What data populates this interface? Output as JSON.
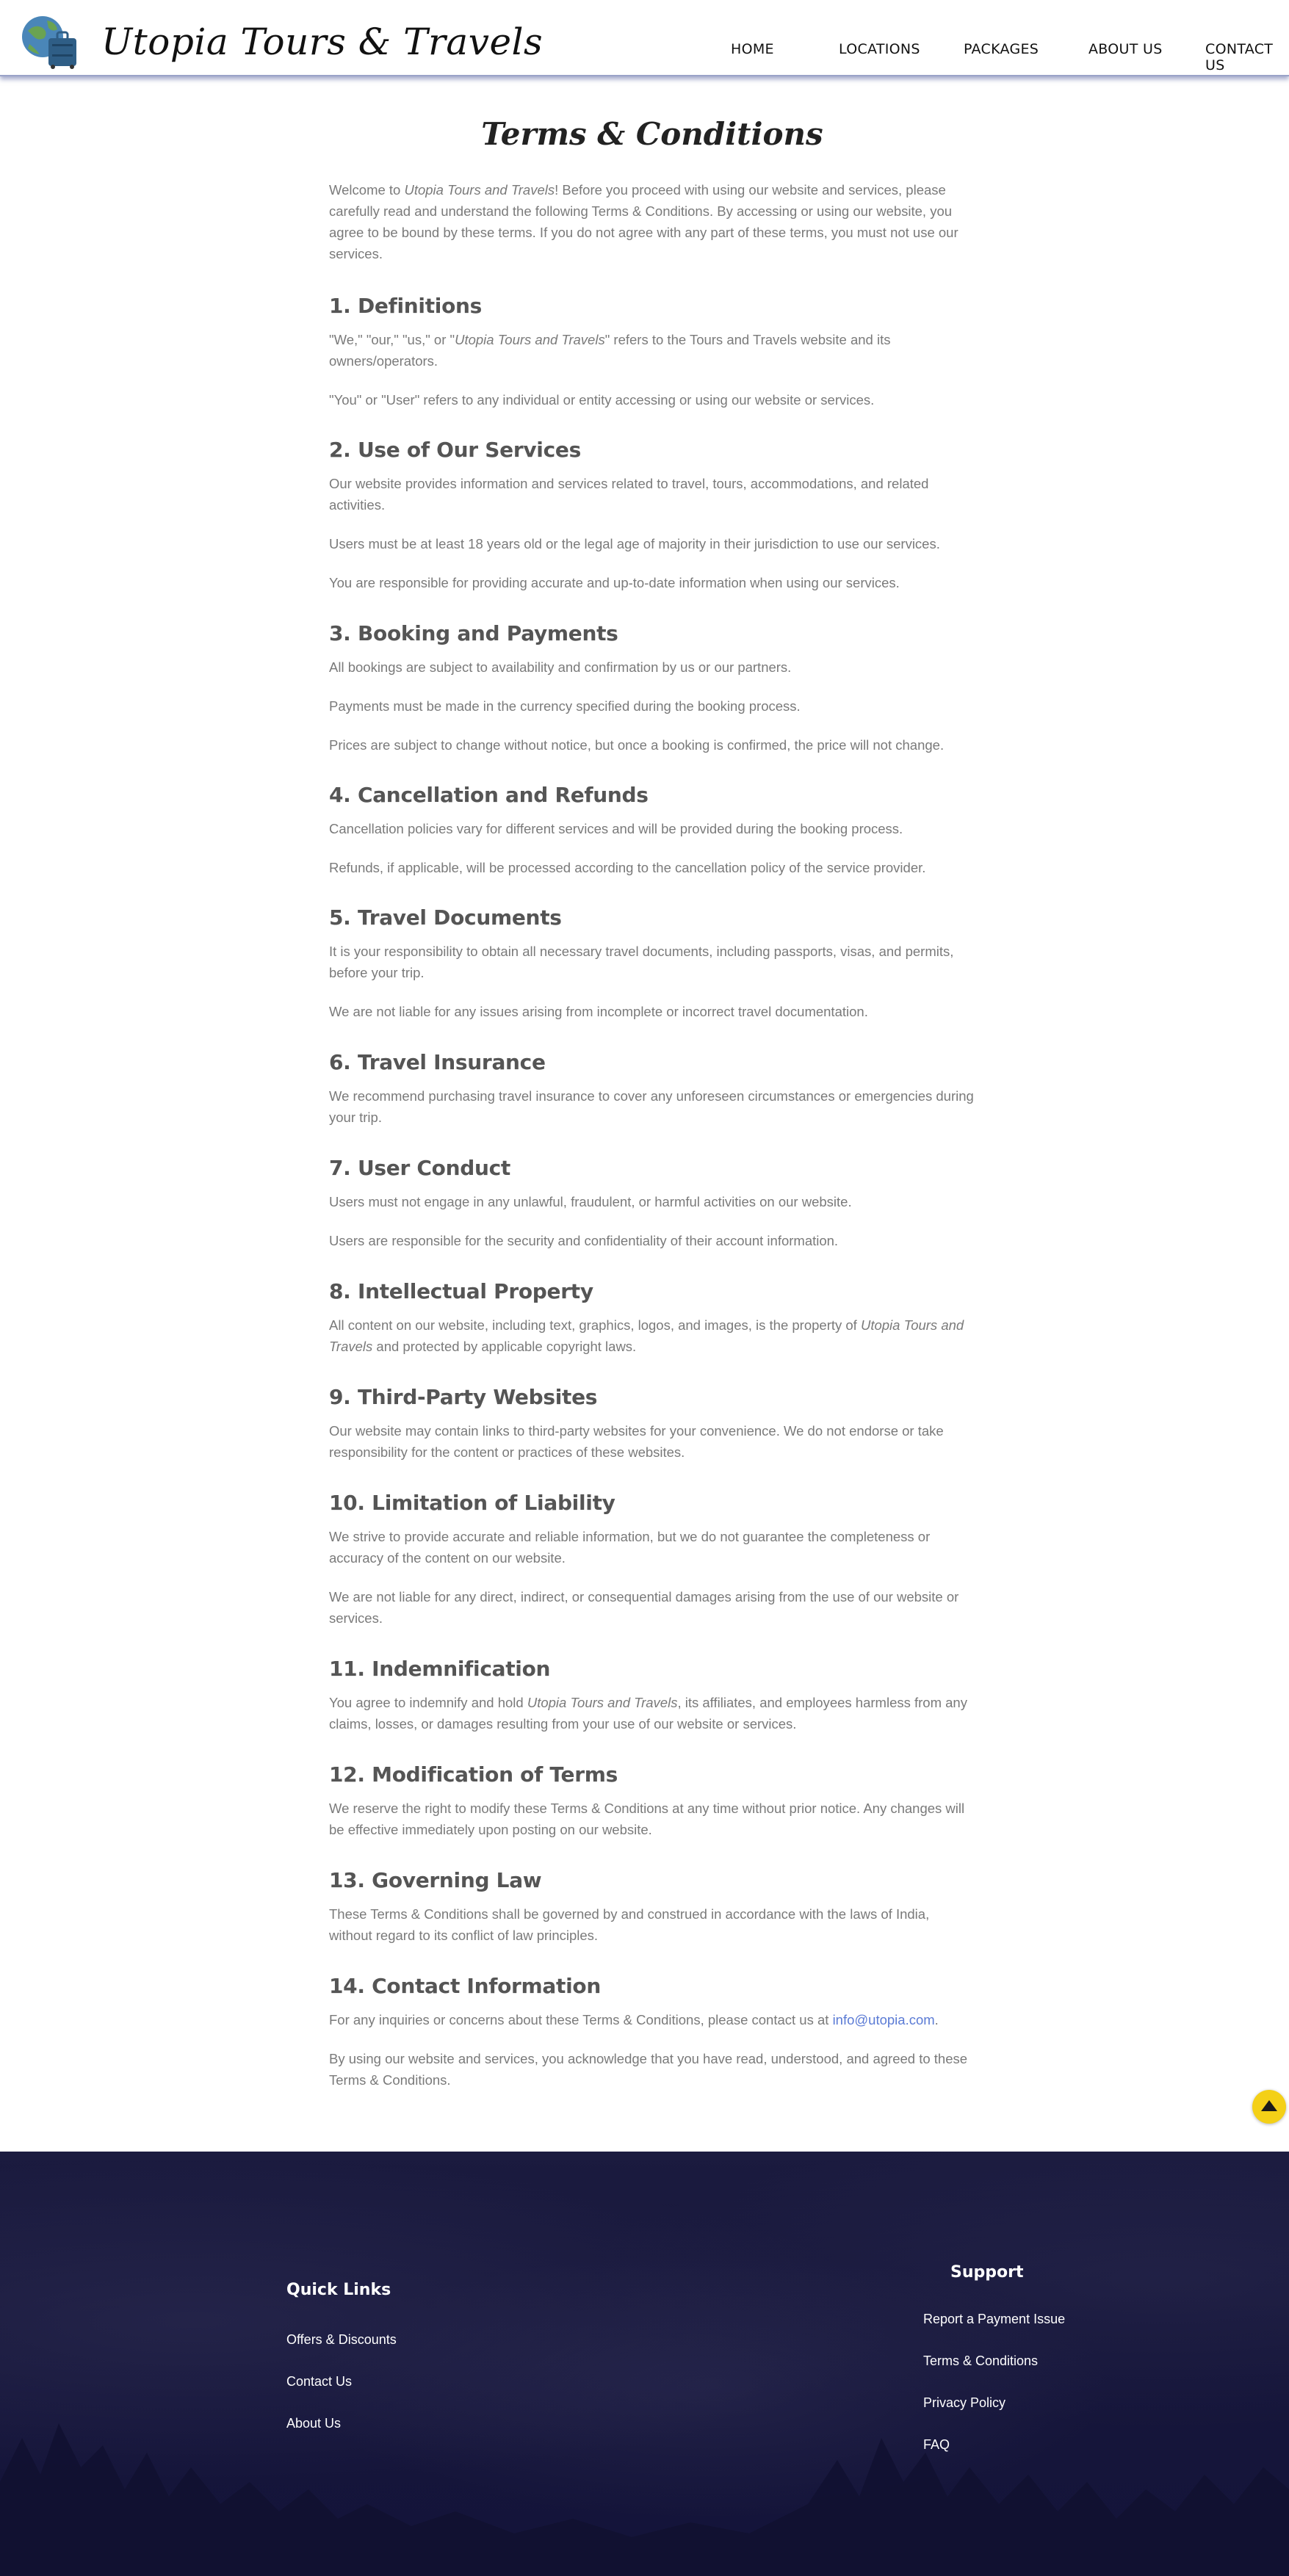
{
  "brand": {
    "name": "Utopia Tours & Travels"
  },
  "nav": {
    "items": [
      "HOME",
      "LOCATIONS",
      "PACKAGES",
      "ABOUT US",
      "CONTACT US"
    ]
  },
  "page": {
    "title": "Terms & Conditions",
    "intro": {
      "p1": "Welcome to ",
      "em1": "Utopia Tours and Travels",
      "p2": "! Before you proceed with using our website and services, please carefully read and understand the following Terms & Conditions. By accessing or using our website, you agree to be bound by these terms. If you do not agree with any part of these terms, you must not use our services."
    },
    "sections": {
      "definitions": {
        "heading": "1. Definitions",
        "p1a": "\"We,\" \"our,\" \"us,\" or \"",
        "p1em": "Utopia Tours and Travels",
        "p1b": "\" refers to the Tours and Travels website and its owners/operators.",
        "p2": "\"You\" or \"User\" refers to any individual or entity accessing or using our website or services."
      },
      "use": {
        "heading": "2. Use of Our Services",
        "p1": "Our website provides information and services related to travel, tours, accommodations, and related activities.",
        "p2": "Users must be at least 18 years old or the legal age of majority in their jurisdiction to use our services.",
        "p3": "You are responsible for providing accurate and up-to-date information when using our services."
      },
      "booking": {
        "heading": "3. Booking and Payments",
        "p1": "All bookings are subject to availability and confirmation by us or our partners.",
        "p2": "Payments must be made in the currency specified during the booking process.",
        "p3": "Prices are subject to change without notice, but once a booking is confirmed, the price will not change."
      },
      "cancellation": {
        "heading": "4. Cancellation and Refunds",
        "p1": "Cancellation policies vary for different services and will be provided during the booking process.",
        "p2": "Refunds, if applicable, will be processed according to the cancellation policy of the service provider."
      },
      "documents": {
        "heading": "5. Travel Documents",
        "p1": "It is your responsibility to obtain all necessary travel documents, including passports, visas, and permits, before your trip.",
        "p2": "We are not liable for any issues arising from incomplete or incorrect travel documentation."
      },
      "insurance": {
        "heading": "6. Travel Insurance",
        "p1": "We recommend purchasing travel insurance to cover any unforeseen circumstances or emergencies during your trip."
      },
      "conduct": {
        "heading": "7. User Conduct",
        "p1": "Users must not engage in any unlawful, fraudulent, or harmful activities on our website.",
        "p2": "Users are responsible for the security and confidentiality of their account information."
      },
      "ip": {
        "heading": "8. Intellectual Property",
        "p1a": "All content on our website, including text, graphics, logos, and images, is the property of ",
        "p1em": "Utopia Tours and Travels",
        "p1b": " and protected by applicable copyright laws."
      },
      "thirdparty": {
        "heading": "9. Third-Party Websites",
        "p1": "Our website may contain links to third-party websites for your convenience. We do not endorse or take responsibility for the content or practices of these websites."
      },
      "liability": {
        "heading": "10. Limitation of Liability",
        "p1": "We strive to provide accurate and reliable information, but we do not guarantee the completeness or accuracy of the content on our website.",
        "p2": "We are not liable for any direct, indirect, or consequential damages arising from the use of our website or services."
      },
      "indemnification": {
        "heading": "11. Indemnification",
        "p1a": "You agree to indemnify and hold ",
        "p1em": "Utopia Tours and Travels",
        "p1b": ", its affiliates, and employees harmless from any claims, losses, or damages resulting from your use of our website or services."
      },
      "modification": {
        "heading": "12. Modification of Terms",
        "p1": "We reserve the right to modify these Terms & Conditions at any time without prior notice. Any changes will be effective immediately upon posting on our website."
      },
      "law": {
        "heading": "13. Governing Law",
        "p1": "These Terms & Conditions shall be governed by and construed in accordance with the laws of India, without regard to its conflict of law principles."
      },
      "contact": {
        "heading": "14. Contact Information",
        "p1a": "For any inquiries or concerns about these Terms & Conditions, please contact us at ",
        "email": "info@utopia.com",
        "p1b": ".",
        "p2": "By using our website and services, you acknowledge that you have read, understood, and agreed to these Terms & Conditions."
      }
    }
  },
  "footer": {
    "quick_links": {
      "heading": "Quick Links",
      "items": [
        "Offers & Discounts",
        "Contact Us",
        "About Us"
      ]
    },
    "support": {
      "heading": "Support",
      "items": [
        "Report a Payment Issue",
        "Terms & Conditions",
        "Privacy Policy",
        "FAQ"
      ]
    }
  },
  "colors": {
    "accent_link": "#5b7bd5",
    "footer_bg": "#16163a",
    "back_to_top": "#f4d017"
  },
  "icons": {
    "logo": "globe-suitcase-icon",
    "back_to_top": "arrow-up-icon"
  }
}
